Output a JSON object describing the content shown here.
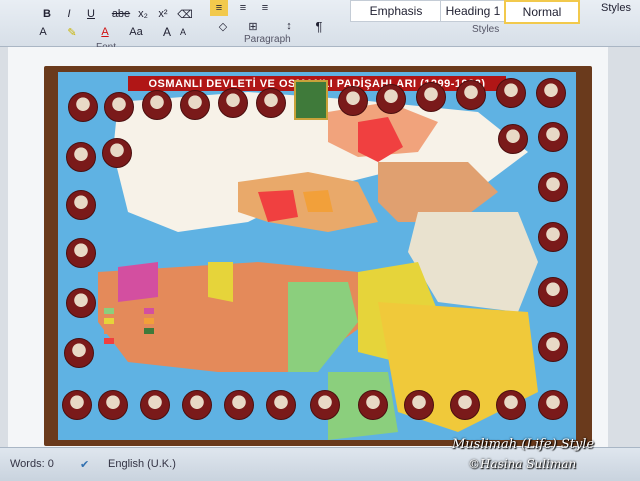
{
  "ribbon": {
    "font_group_label": "Font",
    "paragraph_group_label": "Paragraph",
    "styles_group_label": "Styles",
    "bold": "B",
    "italic": "I",
    "underline": "U",
    "strikethrough": "abe",
    "subscript": "x₂",
    "superscript": "x²",
    "grow_font": "A",
    "shrink_font": "A",
    "change_case": "Aa",
    "font_color": "A",
    "show_marks": "¶",
    "styles": [
      "Emphasis",
      "Heading 1",
      "Normal"
    ],
    "styles_menu": "Styles"
  },
  "document": {
    "poster_title": "OSMANLI DEVLETİ VE OSMANLI PADİŞAHLARI (1299-1922)"
  },
  "status_bar": {
    "words": "Words: 0",
    "language": "English (U.K.)"
  },
  "watermark": {
    "line1": "Muslimah (Life) Style",
    "line2": "©Hasina Suliman"
  },
  "colors": {
    "title_red": "#b01616",
    "frame_brown": "#6a3a1c",
    "sea_blue": "#5fb2e3"
  }
}
